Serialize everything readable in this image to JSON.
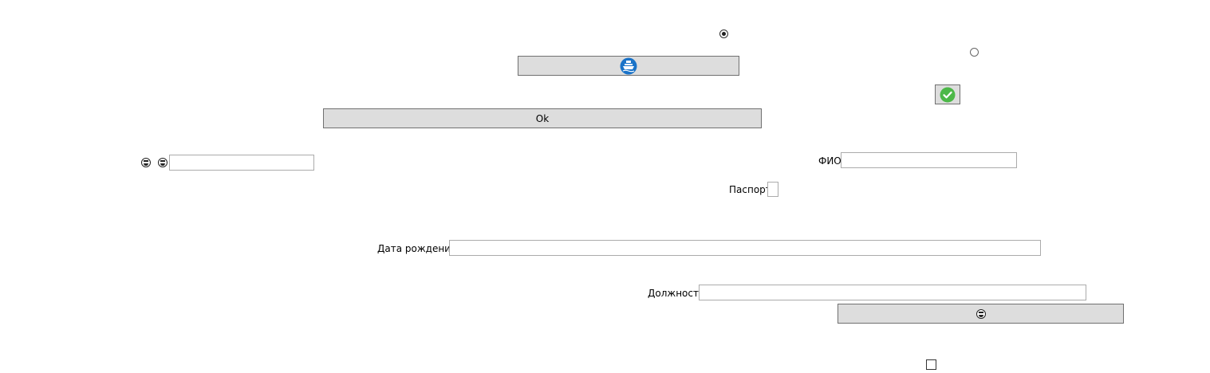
{
  "buttons": {
    "ok_label": "Ok"
  },
  "fields": {
    "fio_label": "ФИО",
    "passport_label": "Паспорт",
    "birth_date_label": "Дата рождения",
    "position_label": "Должность"
  },
  "icons": {
    "ship_button_icon": "ship-icon",
    "confirm_icon": "green-check-icon",
    "laugh_icon": "laughing-face-icon",
    "grin_icon": "grinning-face-icon"
  },
  "colors": {
    "button_bg": "#dddddd",
    "button_border": "#707070",
    "ship_icon_blue": "#1a73c8",
    "check_green": "#4cb848"
  },
  "radios": [
    {
      "checked": true
    },
    {
      "checked": false
    }
  ],
  "checkbox": {
    "checked": false
  }
}
